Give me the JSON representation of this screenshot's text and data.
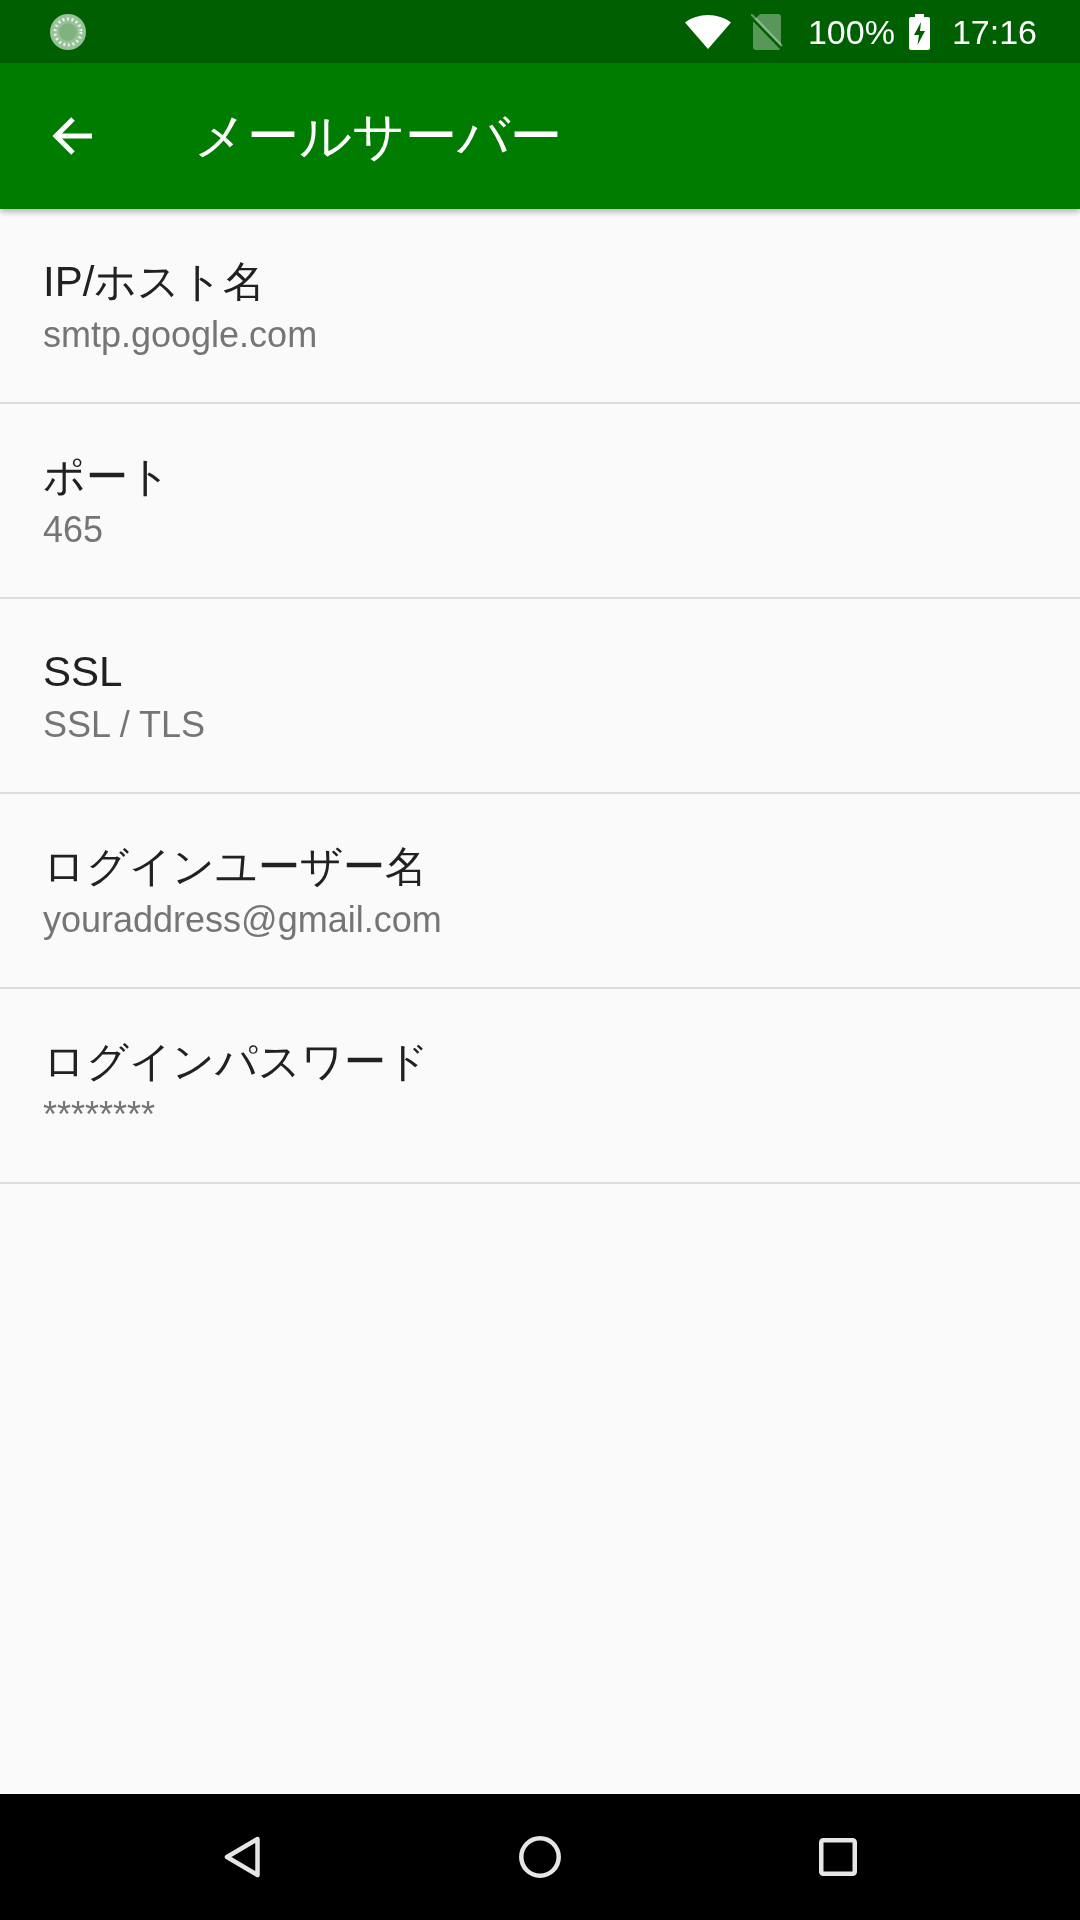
{
  "status_bar": {
    "battery": "100%",
    "time": "17:16"
  },
  "app_bar": {
    "title": "メールサーバー"
  },
  "settings": [
    {
      "title": "IP/ホスト名",
      "value": "smtp.google.com"
    },
    {
      "title": "ポート",
      "value": "465"
    },
    {
      "title": "SSL",
      "value": "SSL / TLS"
    },
    {
      "title": "ログインユーザー名",
      "value": "youraddress@gmail.com"
    },
    {
      "title": "ログインパスワード",
      "value": "********"
    }
  ]
}
